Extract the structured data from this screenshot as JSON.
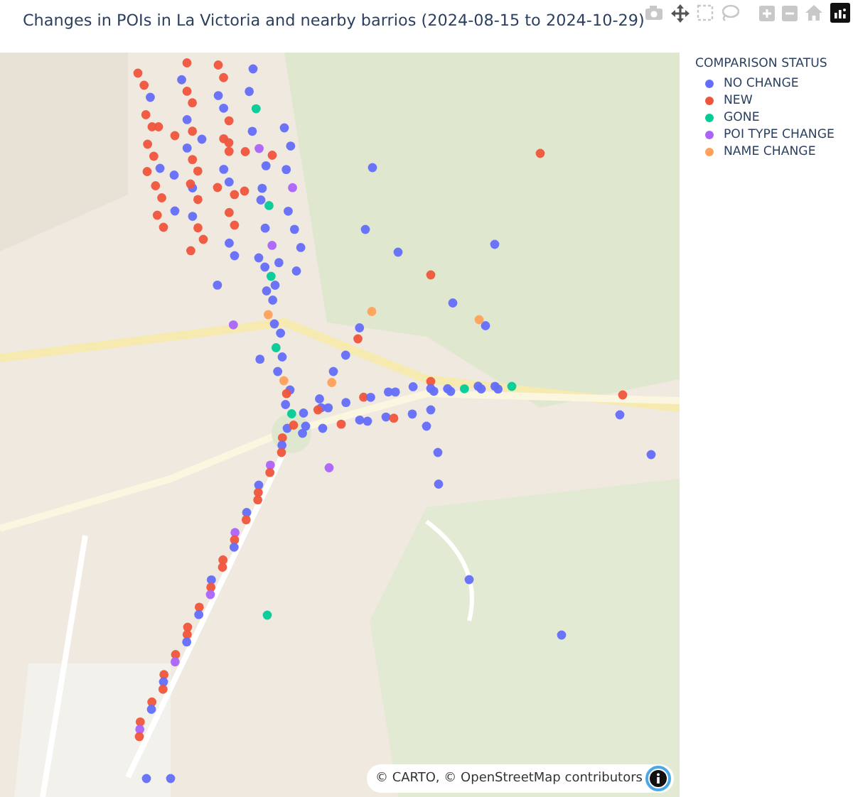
{
  "title": "Changes in POIs in La Victoria and nearby barrios (2024-08-15 to 2024-10-29)",
  "legend": {
    "title": "COMPARISON STATUS",
    "items": [
      {
        "label": "NO CHANGE",
        "color": "#636efa"
      },
      {
        "label": "NEW",
        "color": "#ef553b"
      },
      {
        "label": "GONE",
        "color": "#00cc96"
      },
      {
        "label": "POI TYPE CHANGE",
        "color": "#ab63fa"
      },
      {
        "label": "NAME CHANGE",
        "color": "#ffa15a"
      }
    ]
  },
  "attribution": "© CARTO, © OpenStreetMap contributors"
}
